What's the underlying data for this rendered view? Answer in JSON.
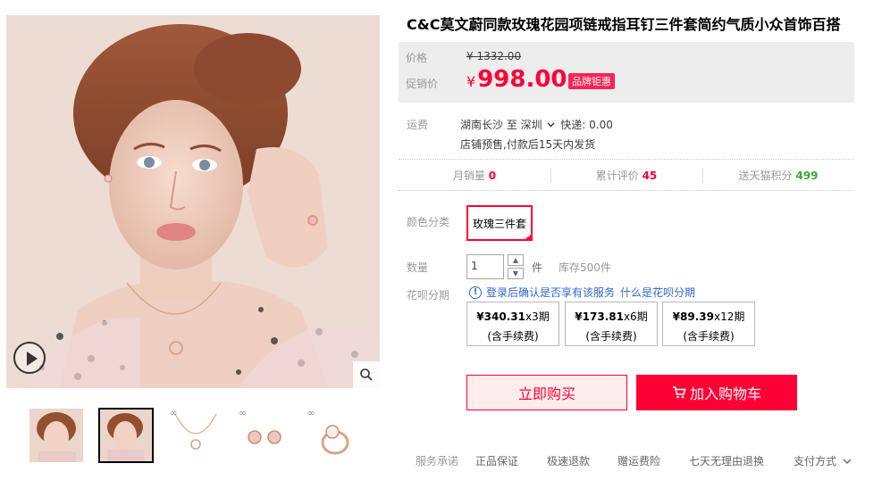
{
  "product": {
    "title": "C&C莫文蔚同款玫瑰花园项链戒指耳钉三件套简约气质小众首饰百搭"
  },
  "price": {
    "label": "价格",
    "original": "¥ 1332.00",
    "promo_label": "促销价",
    "currency": "¥",
    "promo": "998.00",
    "badge": "品牌钜惠"
  },
  "shipping": {
    "label": "运费",
    "route": "湖南长沙  至  深圳",
    "express": "快递: 0.00",
    "note": "店铺预售,付款后15天内发货"
  },
  "stats": {
    "monthly_sales_label": "月销量",
    "monthly_sales": "0",
    "reviews_label": "累计评价",
    "reviews": "45",
    "points_label": "送天猫积分",
    "points": "499"
  },
  "options": {
    "color_label": "颜色分类",
    "color_value": "玫瑰三件套",
    "qty_label": "数量",
    "qty_value": "1",
    "unit": "件",
    "stock": "库存500件",
    "huabei_label": "花呗分期",
    "huabei_tip": "登录后确认是否享有该服务",
    "huabei_link": "什么是花呗分期",
    "installments": [
      {
        "amount": "¥340.31",
        "periods": "x3期",
        "fee": "(含手续费)"
      },
      {
        "amount": "¥173.81",
        "periods": "x6期",
        "fee": "(含手续费)"
      },
      {
        "amount": "¥89.39",
        "periods": "x12期",
        "fee": "(含手续费)"
      }
    ]
  },
  "actions": {
    "buy_now": "立即购买",
    "add_cart": "加入购物车"
  },
  "services": {
    "label": "服务承诺",
    "items": [
      "正品保证",
      "极速退款",
      "赠运费险",
      "七天无理由退换"
    ],
    "payment": "支付方式"
  },
  "gallery": {
    "thumb_tag": "∞"
  },
  "colors": {
    "accent": "#ff0036",
    "link": "#3366cc",
    "price_bg": "#ededed"
  }
}
